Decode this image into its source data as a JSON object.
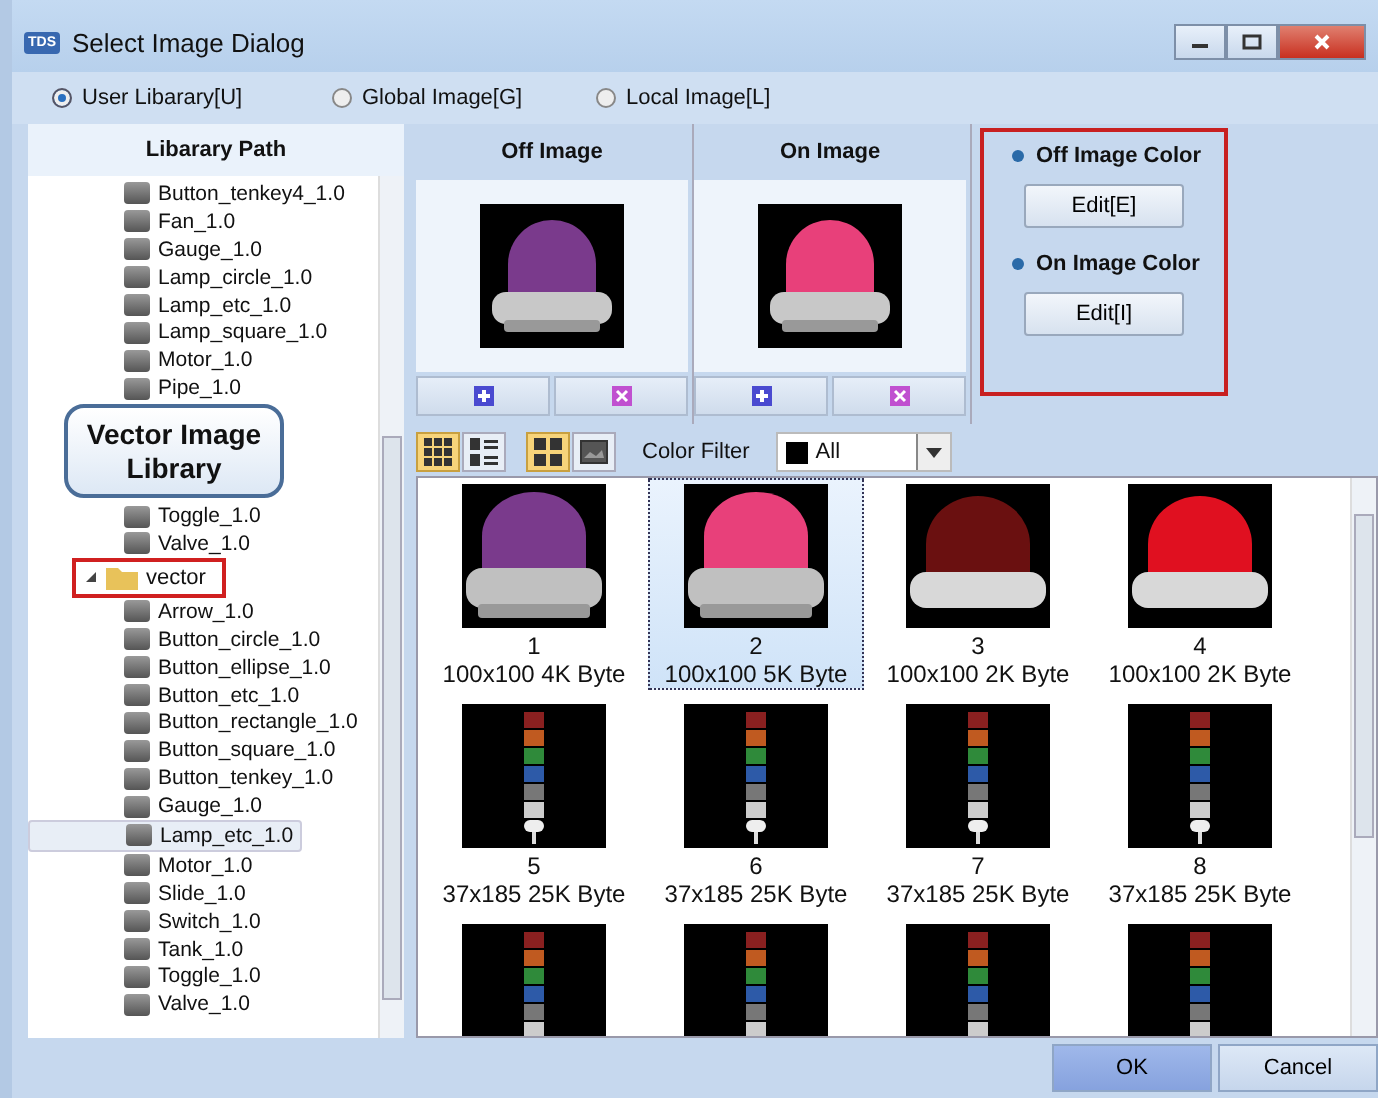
{
  "window": {
    "title": "Select Image Dialog",
    "app_badge": "TDS"
  },
  "sources": [
    {
      "label": "User Libarary[U]",
      "selected": true
    },
    {
      "label": "Global Image[G]",
      "selected": false
    },
    {
      "label": "Local Image[L]",
      "selected": false
    }
  ],
  "tree": {
    "header": "Libarary Path",
    "groups": [
      {
        "children": [
          {
            "label": "Button_tenkey4_1.0",
            "selected": false
          },
          {
            "label": "Fan_1.0",
            "selected": false
          },
          {
            "label": "Gauge_1.0",
            "selected": false
          },
          {
            "label": "Lamp_circle_1.0",
            "selected": false
          },
          {
            "label": "Lamp_etc_1.0",
            "selected": false
          },
          {
            "label": "Lamp_square_1.0",
            "selected": false
          },
          {
            "label": "Motor_1.0",
            "selected": false
          },
          {
            "label": "Pipe_1.0",
            "selected": false
          },
          {
            "label": "Toggle_1.0",
            "selected": false
          },
          {
            "label": "Valve_1.0",
            "selected": false
          }
        ]
      },
      {
        "label": "vector",
        "expanded": true,
        "children": [
          {
            "label": "Arrow_1.0",
            "selected": false
          },
          {
            "label": "Button_circle_1.0",
            "selected": false
          },
          {
            "label": "Button_ellipse_1.0",
            "selected": false
          },
          {
            "label": "Button_etc_1.0",
            "selected": false
          },
          {
            "label": "Button_rectangle_1.0",
            "selected": false
          },
          {
            "label": "Button_square_1.0",
            "selected": false
          },
          {
            "label": "Button_tenkey_1.0",
            "selected": false
          },
          {
            "label": "Gauge_1.0",
            "selected": false
          },
          {
            "label": "Lamp_etc_1.0",
            "selected": true
          },
          {
            "label": "Motor_1.0",
            "selected": false
          },
          {
            "label": "Slide_1.0",
            "selected": false
          },
          {
            "label": "Switch_1.0",
            "selected": false
          },
          {
            "label": "Tank_1.0",
            "selected": false
          },
          {
            "label": "Toggle_1.0",
            "selected": false
          },
          {
            "label": "Valve_1.0",
            "selected": false
          }
        ]
      }
    ]
  },
  "callout": {
    "text": "Vector Image Library"
  },
  "previews": [
    {
      "title": "Off Image",
      "color": "#7a3a8c"
    },
    {
      "title": "On Image",
      "color": "#e8407a"
    }
  ],
  "color_settings": [
    {
      "label": "Off Image Color",
      "button": "Edit[E]"
    },
    {
      "label": "On Image Color",
      "button": "Edit[I]"
    }
  ],
  "toolbar": {
    "color_filter_label": "Color Filter",
    "color_filter_value": "All"
  },
  "images": [
    {
      "kind": "dome",
      "color": "#7a3a8c",
      "number": "1",
      "size": "100x100 4K Byte",
      "selected": false
    },
    {
      "kind": "dome",
      "color": "#e8407a",
      "number": "2",
      "size": "100x100 5K Byte",
      "selected": true
    },
    {
      "kind": "flatdome",
      "color": "#6a1010",
      "number": "3",
      "size": "100x100 2K Byte",
      "selected": false
    },
    {
      "kind": "flatdome",
      "color": "#e01020",
      "number": "4",
      "size": "100x100 2K Byte",
      "selected": false
    },
    {
      "kind": "tower",
      "number": "5",
      "size": "37x185 25K Byte",
      "selected": false
    },
    {
      "kind": "tower",
      "number": "6",
      "size": "37x185 25K Byte",
      "selected": false
    },
    {
      "kind": "tower",
      "number": "7",
      "size": "37x185 25K Byte",
      "selected": false
    },
    {
      "kind": "tower",
      "number": "8",
      "size": "37x185 25K Byte",
      "selected": false
    },
    {
      "kind": "tower",
      "selected": false
    },
    {
      "kind": "tower",
      "selected": false
    },
    {
      "kind": "tower",
      "selected": false
    },
    {
      "kind": "tower",
      "selected": false
    }
  ],
  "buttons": [
    "OK",
    "Cancel"
  ]
}
